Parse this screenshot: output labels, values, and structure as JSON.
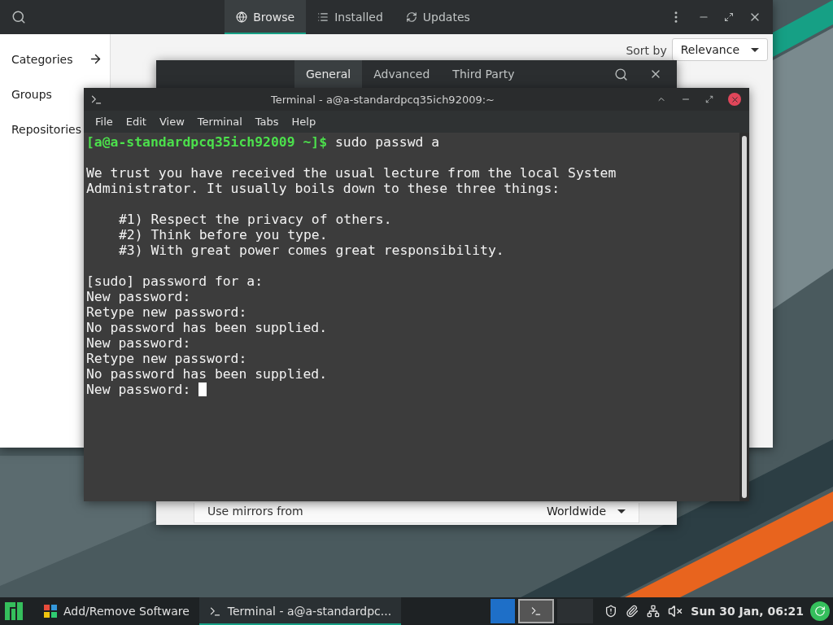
{
  "software": {
    "tabs": [
      {
        "label": "Browse",
        "selected": true
      },
      {
        "label": "Installed",
        "selected": false
      },
      {
        "label": "Updates",
        "selected": false
      }
    ],
    "sidebar": [
      {
        "label": "Categories",
        "has_arrow": true
      },
      {
        "label": "Groups",
        "has_arrow": false
      },
      {
        "label": "Repositories",
        "has_arrow": false
      }
    ],
    "sort": {
      "label": "Sort by",
      "value": "Relevance"
    }
  },
  "preferences": {
    "tabs": [
      {
        "label": "General",
        "selected": true
      },
      {
        "label": "Advanced",
        "selected": false
      },
      {
        "label": "Third Party",
        "selected": false
      }
    ],
    "rows": [
      {
        "label": "Use mirrors from",
        "value": "Worldwide"
      }
    ]
  },
  "terminal": {
    "title": "Terminal - a@a-standardpcq35ich92009:~",
    "menu": [
      "File",
      "Edit",
      "View",
      "Terminal",
      "Tabs",
      "Help"
    ],
    "lines": [
      {
        "kind": "prompt",
        "prompt": "[a@a-standardpcq35ich92009 ~]$",
        "command": "sudo passwd a"
      },
      {
        "kind": "blank"
      },
      {
        "kind": "text",
        "text": "We trust you have received the usual lecture from the local System"
      },
      {
        "kind": "text",
        "text": "Administrator. It usually boils down to these three things:"
      },
      {
        "kind": "blank"
      },
      {
        "kind": "indented",
        "text": "#1) Respect the privacy of others."
      },
      {
        "kind": "indented",
        "text": "#2) Think before you type."
      },
      {
        "kind": "indented",
        "text": "#3) With great power comes great responsibility."
      },
      {
        "kind": "blank"
      },
      {
        "kind": "text",
        "text": "[sudo] password for a:"
      },
      {
        "kind": "text",
        "text": "New password:"
      },
      {
        "kind": "text",
        "text": "Retype new password:"
      },
      {
        "kind": "text",
        "text": "No password has been supplied."
      },
      {
        "kind": "text",
        "text": "New password:"
      },
      {
        "kind": "text",
        "text": "Retype new password:"
      },
      {
        "kind": "text",
        "text": "No password has been supplied."
      },
      {
        "kind": "input",
        "text": "New password:"
      }
    ]
  },
  "taskbar": {
    "apps": [
      {
        "label": "Add/Remove Software",
        "selected": false
      },
      {
        "label": "Terminal - a@a-standardpc...",
        "selected": true
      }
    ],
    "clock": "Sun 30 Jan, 06:21"
  }
}
